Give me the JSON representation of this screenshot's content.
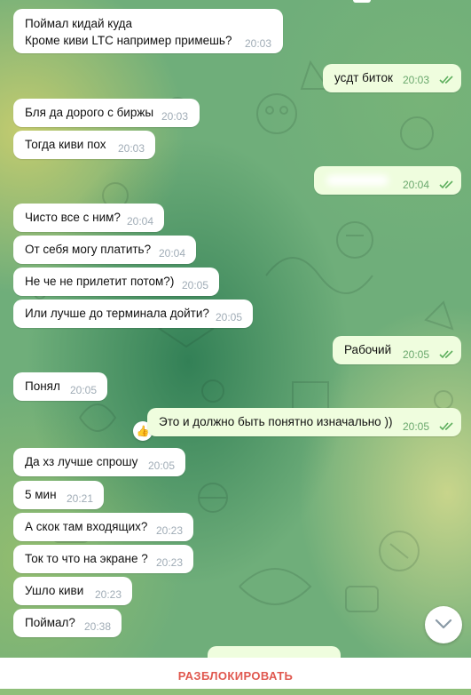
{
  "messages": [
    {
      "text_lines": [
        "Поймал кидай куда",
        "Кроме киви LTC например примешь?"
      ],
      "time": "20:03",
      "direction": "in"
    },
    {
      "text": "усдт биток",
      "time": "20:03",
      "direction": "out",
      "status": "read"
    },
    {
      "text": "Бля да дорого с биржы",
      "time": "20:03",
      "direction": "in"
    },
    {
      "text": "Тогда киви пох",
      "time": "20:03",
      "direction": "in"
    },
    {
      "text": "",
      "time": "20:04",
      "direction": "out",
      "status": "read",
      "redacted": true
    },
    {
      "text": "Чисто все с ним?",
      "time": "20:04",
      "direction": "in"
    },
    {
      "text": "От себя могу платить?",
      "time": "20:04",
      "direction": "in"
    },
    {
      "text": "Не че не прилетит потом?)",
      "time": "20:05",
      "direction": "in"
    },
    {
      "text": "Или лучше до терминала дойти?",
      "time": "20:05",
      "direction": "in"
    },
    {
      "text": "Рабочий",
      "time": "20:05",
      "direction": "out",
      "status": "read"
    },
    {
      "text": "Понял",
      "time": "20:05",
      "direction": "in"
    },
    {
      "text": "Это и должно быть понятно изначально ))",
      "time": "20:05",
      "direction": "out",
      "status": "read",
      "reaction": "👍"
    },
    {
      "text": "Да хз лучше спрошу",
      "time": "20:05",
      "direction": "in"
    },
    {
      "text": "5 мин",
      "time": "20:21",
      "direction": "in"
    },
    {
      "text": "А скок там входящих?",
      "time": "20:23",
      "direction": "in"
    },
    {
      "text": "Ток то что на экране ?",
      "time": "20:23",
      "direction": "in"
    },
    {
      "text": "Ушло киви",
      "time": "20:23",
      "direction": "in"
    },
    {
      "text": "Поймал?",
      "time": "20:38",
      "direction": "in"
    }
  ],
  "bottom_bar": {
    "unblock_label": "РАЗБЛОКИРОВАТЬ"
  },
  "icons": {
    "read_status": "double-check-icon",
    "scroll_down": "chevron-down-icon",
    "reaction": "thumbs-up-icon"
  },
  "colors": {
    "incoming_bubble": "#ffffff",
    "outgoing_bubble": "#effdde",
    "read_check": "#5cae5c",
    "unblock_text": "#e0584f"
  }
}
